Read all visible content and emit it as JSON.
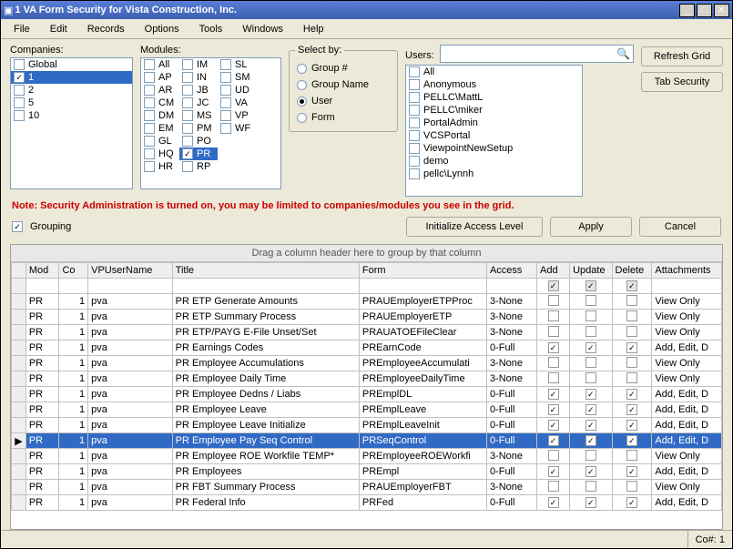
{
  "window": {
    "title": "1 VA Form Security for Vista Construction, Inc."
  },
  "menu": [
    "File",
    "Edit",
    "Records",
    "Options",
    "Tools",
    "Windows",
    "Help"
  ],
  "labels": {
    "companies": "Companies:",
    "modules": "Modules:",
    "selectby": "Select by:",
    "users": "Users:",
    "grouping": "Grouping",
    "note": "Note: Security Administration is turned on, you may be limited to companies/modules you see in the grid.",
    "grouphdr": "Drag a column header here to group by that column"
  },
  "companies": [
    {
      "label": "Global",
      "checked": false,
      "sel": false
    },
    {
      "label": "1",
      "checked": true,
      "sel": true
    },
    {
      "label": "2",
      "checked": false,
      "sel": false
    },
    {
      "label": "5",
      "checked": false,
      "sel": false
    },
    {
      "label": "10",
      "checked": false,
      "sel": false
    }
  ],
  "modules": {
    "c1": [
      "All",
      "AP",
      "AR",
      "CM",
      "DM",
      "EM",
      "GL",
      "HQ",
      "HR"
    ],
    "c2": [
      "IM",
      "IN",
      "JB",
      "JC",
      "MS",
      "PM",
      "PO",
      "PR",
      "RP"
    ],
    "c3": [
      "SL",
      "SM",
      "UD",
      "VA",
      "VP",
      "WF"
    ],
    "checked": "PR",
    "selected": "PR"
  },
  "selectby": {
    "items": [
      "Group #",
      "Group Name",
      "User",
      "Form"
    ],
    "selected": "User"
  },
  "users": [
    "All",
    "Anonymous",
    "PELLC\\MattL",
    "PELLC\\miker",
    "PortalAdmin",
    "VCSPortal",
    "ViewpointNewSetup",
    "demo",
    "pellc\\Lynnh"
  ],
  "buttons": {
    "refresh": "Refresh Grid",
    "tabsec": "Tab Security",
    "init": "Initialize Access Level",
    "apply": "Apply",
    "cancel": "Cancel"
  },
  "grouping": true,
  "search": {
    "placeholder": ""
  },
  "columns": [
    "Mod",
    "Co",
    "VPUserName",
    "Title",
    "Form",
    "Access",
    "Add",
    "Update",
    "Delete",
    "Attachments"
  ],
  "rows": [
    {
      "mod": "PR",
      "co": "1",
      "user": "pva",
      "title": "PR ETP Generate Amounts",
      "form": "PRAUEmployerETPProc",
      "access": "3-None",
      "add": false,
      "upd": false,
      "del": false,
      "att": "View Only"
    },
    {
      "mod": "PR",
      "co": "1",
      "user": "pva",
      "title": "PR ETP Summary Process",
      "form": "PRAUEmployerETP",
      "access": "3-None",
      "add": false,
      "upd": false,
      "del": false,
      "att": "View Only"
    },
    {
      "mod": "PR",
      "co": "1",
      "user": "pva",
      "title": "PR ETP/PAYG E-File Unset/Set",
      "form": "PRAUATOEFileClear",
      "access": "3-None",
      "add": false,
      "upd": false,
      "del": false,
      "att": "View Only"
    },
    {
      "mod": "PR",
      "co": "1",
      "user": "pva",
      "title": "PR Earnings Codes",
      "form": "PREarnCode",
      "access": "0-Full",
      "add": true,
      "upd": true,
      "del": true,
      "att": "Add, Edit, D"
    },
    {
      "mod": "PR",
      "co": "1",
      "user": "pva",
      "title": "PR Employee Accumulations",
      "form": "PREmployeeAccumulati",
      "access": "3-None",
      "add": false,
      "upd": false,
      "del": false,
      "att": "View Only"
    },
    {
      "mod": "PR",
      "co": "1",
      "user": "pva",
      "title": "PR Employee Daily Time",
      "form": "PREmployeeDailyTime",
      "access": "3-None",
      "add": false,
      "upd": false,
      "del": false,
      "att": "View Only"
    },
    {
      "mod": "PR",
      "co": "1",
      "user": "pva",
      "title": "PR Employee Dedns / Liabs",
      "form": "PREmplDL",
      "access": "0-Full",
      "add": true,
      "upd": true,
      "del": true,
      "att": "Add, Edit, D"
    },
    {
      "mod": "PR",
      "co": "1",
      "user": "pva",
      "title": "PR Employee Leave",
      "form": "PREmplLeave",
      "access": "0-Full",
      "add": true,
      "upd": true,
      "del": true,
      "att": "Add, Edit, D"
    },
    {
      "mod": "PR",
      "co": "1",
      "user": "pva",
      "title": "PR Employee Leave Initialize",
      "form": "PREmplLeaveInit",
      "access": "0-Full",
      "add": true,
      "upd": true,
      "del": true,
      "att": "Add, Edit, D"
    },
    {
      "mod": "PR",
      "co": "1",
      "user": "pva",
      "title": "PR Employee Pay Seq Control",
      "form": "PRSeqControl",
      "access": "0-Full",
      "add": true,
      "upd": true,
      "del": true,
      "att": "Add, Edit, D",
      "sel": true
    },
    {
      "mod": "PR",
      "co": "1",
      "user": "pva",
      "title": "PR Employee ROE Workfile TEMP*",
      "form": "PREmployeeROEWorkfi",
      "access": "3-None",
      "add": false,
      "upd": false,
      "del": false,
      "att": "View Only"
    },
    {
      "mod": "PR",
      "co": "1",
      "user": "pva",
      "title": "PR Employees",
      "form": "PREmpl",
      "access": "0-Full",
      "add": true,
      "upd": true,
      "del": true,
      "att": "Add, Edit, D"
    },
    {
      "mod": "PR",
      "co": "1",
      "user": "pva",
      "title": "PR FBT Summary Process",
      "form": "PRAUEmployerFBT",
      "access": "3-None",
      "add": false,
      "upd": false,
      "del": false,
      "att": "View Only"
    },
    {
      "mod": "PR",
      "co": "1",
      "user": "pva",
      "title": "PR Federal Info",
      "form": "PRFed",
      "access": "0-Full",
      "add": true,
      "upd": true,
      "del": true,
      "att": "Add, Edit, D"
    }
  ],
  "filterrow": {
    "add": true,
    "upd": true,
    "del": true
  },
  "status": {
    "co": "Co#: 1"
  }
}
